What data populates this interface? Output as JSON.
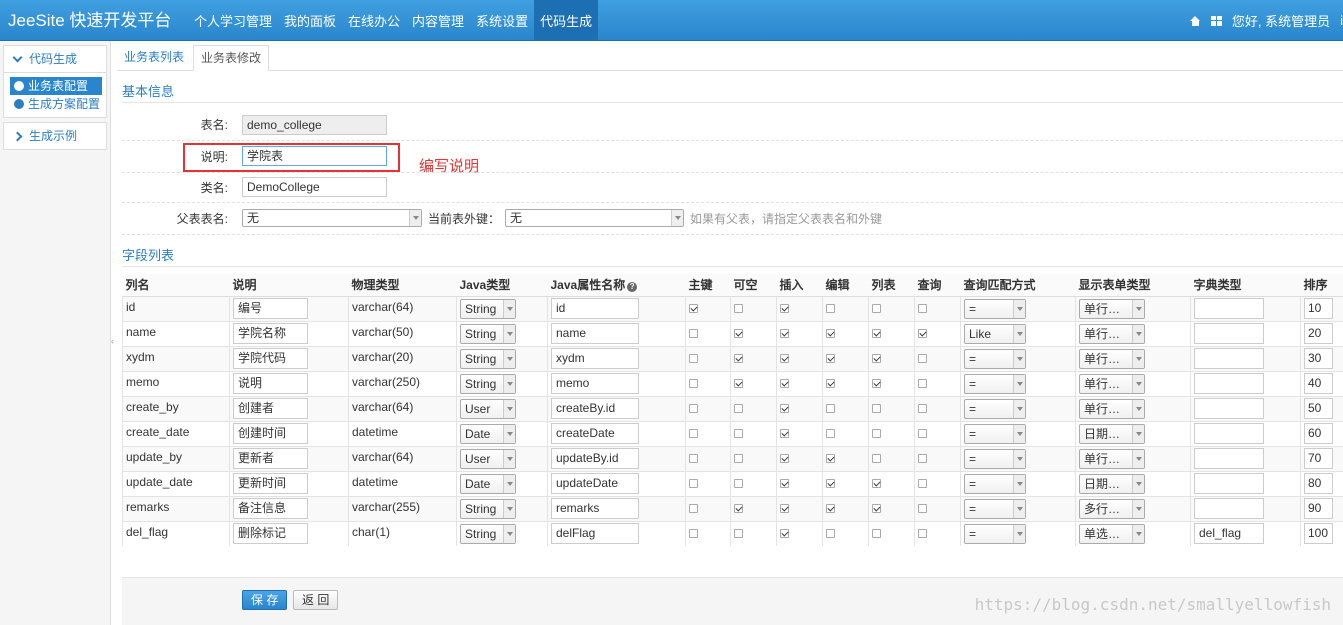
{
  "app": {
    "brand": "JeeSite 快速开发平台"
  },
  "nav": [
    "个人学习管理",
    "我的面板",
    "在线办公",
    "内容管理",
    "系统设置",
    "代码生成"
  ],
  "user": {
    "greeting": "您好, 系统管理员",
    "extra": "i"
  },
  "sidebar": {
    "group1": {
      "title": "代码生成",
      "items": [
        "业务表配置",
        "生成方案配置"
      ]
    },
    "group2": {
      "title": "生成示例"
    },
    "handle": "‹"
  },
  "tabs": [
    "业务表列表",
    "业务表修改"
  ],
  "form": {
    "legend": "基本信息",
    "table_name_label": "表名:",
    "table_name": "demo_college",
    "comment_label": "说明:",
    "comment": "学院表",
    "class_label": "类名:",
    "class_name": "DemoCollege",
    "parent_label": "父表表名:",
    "parent_value": "无",
    "fk_label": "当前表外键：",
    "fk_value": "无",
    "hint": "如果有父表，请指定父表表名和外键"
  },
  "annotation": "编写说明",
  "columns": {
    "legend": "字段列表",
    "headers": [
      "列名",
      "说明",
      "物理类型",
      "Java类型",
      "Java属性名称",
      "主键",
      "可空",
      "插入",
      "编辑",
      "列表",
      "查询",
      "查询匹配方式",
      "显示表单类型",
      "字典类型",
      "排序"
    ],
    "help": "?",
    "rows": [
      {
        "name": "id",
        "comment": "编号",
        "jdbc": "varchar(64)",
        "jtype": "String",
        "jfield": "id",
        "pk": true,
        "nul": false,
        "ins": true,
        "edit": false,
        "list": false,
        "query": false,
        "match": "=",
        "show": "单行…",
        "dict": "",
        "sort": "10"
      },
      {
        "name": "name",
        "comment": "学院名称",
        "jdbc": "varchar(50)",
        "jtype": "String",
        "jfield": "name",
        "pk": false,
        "nul": true,
        "ins": true,
        "edit": true,
        "list": true,
        "query": true,
        "match": "Like",
        "show": "单行…",
        "dict": "",
        "sort": "20"
      },
      {
        "name": "xydm",
        "comment": "学院代码",
        "jdbc": "varchar(20)",
        "jtype": "String",
        "jfield": "xydm",
        "pk": false,
        "nul": true,
        "ins": true,
        "edit": true,
        "list": true,
        "query": false,
        "match": "=",
        "show": "单行…",
        "dict": "",
        "sort": "30"
      },
      {
        "name": "memo",
        "comment": "说明",
        "jdbc": "varchar(250)",
        "jtype": "String",
        "jfield": "memo",
        "pk": false,
        "nul": true,
        "ins": true,
        "edit": true,
        "list": true,
        "query": false,
        "match": "=",
        "show": "单行…",
        "dict": "",
        "sort": "40"
      },
      {
        "name": "create_by",
        "comment": "创建者",
        "jdbc": "varchar(64)",
        "jtype": "User",
        "jfield": "createBy.id",
        "pk": false,
        "nul": false,
        "ins": true,
        "edit": false,
        "list": false,
        "query": false,
        "match": "=",
        "show": "单行…",
        "dict": "",
        "sort": "50"
      },
      {
        "name": "create_date",
        "comment": "创建时间",
        "jdbc": "datetime",
        "jtype": "Date",
        "jfield": "createDate",
        "pk": false,
        "nul": false,
        "ins": true,
        "edit": false,
        "list": false,
        "query": false,
        "match": "=",
        "show": "日期…",
        "dict": "",
        "sort": "60"
      },
      {
        "name": "update_by",
        "comment": "更新者",
        "jdbc": "varchar(64)",
        "jtype": "User",
        "jfield": "updateBy.id",
        "pk": false,
        "nul": false,
        "ins": true,
        "edit": true,
        "list": false,
        "query": false,
        "match": "=",
        "show": "单行…",
        "dict": "",
        "sort": "70"
      },
      {
        "name": "update_date",
        "comment": "更新时间",
        "jdbc": "datetime",
        "jtype": "Date",
        "jfield": "updateDate",
        "pk": false,
        "nul": false,
        "ins": true,
        "edit": true,
        "list": true,
        "query": false,
        "match": "=",
        "show": "日期…",
        "dict": "",
        "sort": "80"
      },
      {
        "name": "remarks",
        "comment": "备注信息",
        "jdbc": "varchar(255)",
        "jtype": "String",
        "jfield": "remarks",
        "pk": false,
        "nul": true,
        "ins": true,
        "edit": true,
        "list": true,
        "query": false,
        "match": "=",
        "show": "多行…",
        "dict": "",
        "sort": "90"
      },
      {
        "name": "del_flag",
        "comment": "删除标记",
        "jdbc": "char(1)",
        "jtype": "String",
        "jfield": "delFlag",
        "pk": false,
        "nul": false,
        "ins": true,
        "edit": false,
        "list": false,
        "query": false,
        "match": "=",
        "show": "单选…",
        "dict": "del_flag",
        "sort": "100"
      }
    ]
  },
  "buttons": {
    "save": "保 存",
    "back": "返 回"
  },
  "watermark": "https://blog.csdn.net/smallyellowfish",
  "colors": {
    "accent": "#2a86cc",
    "annotation": "#e53333"
  }
}
